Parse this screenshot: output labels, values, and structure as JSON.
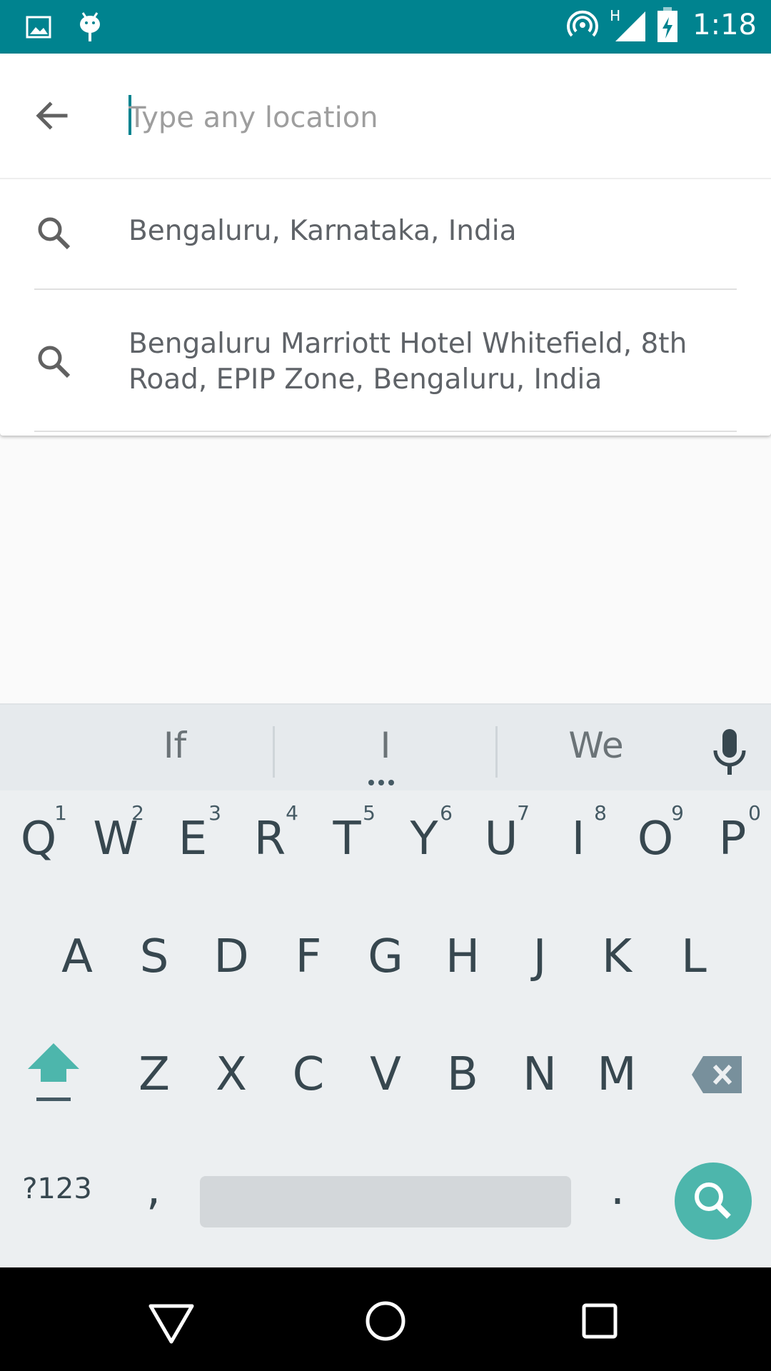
{
  "status_bar": {
    "time": "1:18",
    "network_label": "H",
    "left_icons": [
      "image-icon",
      "android-debug-icon"
    ],
    "right_icons": [
      "hotspot-icon",
      "cellular-signal-icon",
      "battery-charging-icon"
    ],
    "bg_color": "#00838f"
  },
  "search": {
    "placeholder": "Type any location",
    "value": ""
  },
  "results": [
    {
      "text": "Bengaluru, Karnataka, India"
    },
    {
      "text": "Bengaluru Marriott Hotel Whitefield, 8th Road, EPIP Zone, Bengaluru, India"
    }
  ],
  "keyboard": {
    "suggestions": [
      "If",
      "I",
      "We"
    ],
    "row1": [
      {
        "label": "Q",
        "hint": "1"
      },
      {
        "label": "W",
        "hint": "2"
      },
      {
        "label": "E",
        "hint": "3"
      },
      {
        "label": "R",
        "hint": "4"
      },
      {
        "label": "T",
        "hint": "5"
      },
      {
        "label": "Y",
        "hint": "6"
      },
      {
        "label": "U",
        "hint": "7"
      },
      {
        "label": "I",
        "hint": "8"
      },
      {
        "label": "O",
        "hint": "9"
      },
      {
        "label": "P",
        "hint": "0"
      }
    ],
    "row2": [
      "A",
      "S",
      "D",
      "F",
      "G",
      "H",
      "J",
      "K",
      "L"
    ],
    "row3": [
      "Z",
      "X",
      "C",
      "V",
      "B",
      "N",
      "M"
    ],
    "symbols_key": "?123",
    "comma_key": ",",
    "period_key": ".",
    "action_color": "#4db6ac"
  }
}
